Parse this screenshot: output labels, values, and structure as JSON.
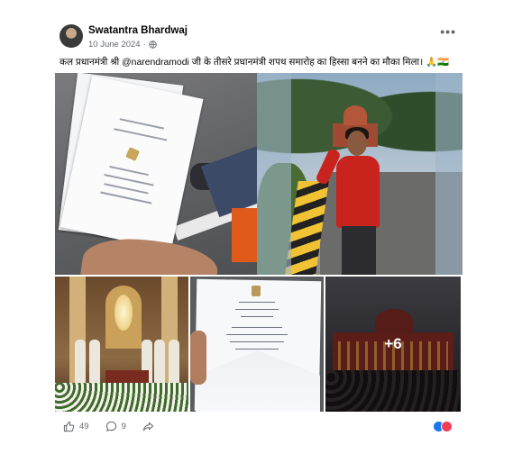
{
  "post": {
    "author": "Swatantra Bhardwaj",
    "date": "10 June 2024",
    "separator": "·",
    "more": "•••",
    "caption": "कल प्रधानमंत्री श्री @narendramodi जी के तीसरे प्रधानमंत्री शपथ समारोह का हिस्सा बनने का मौका मिला। 🙏🇮🇳",
    "extra_photos": "+6"
  },
  "footer": {
    "likes": "49",
    "comments": "9"
  },
  "colors": {
    "like_blue": "#1877f2",
    "love_red": "#f33e58",
    "meta_grey": "#65676b"
  }
}
